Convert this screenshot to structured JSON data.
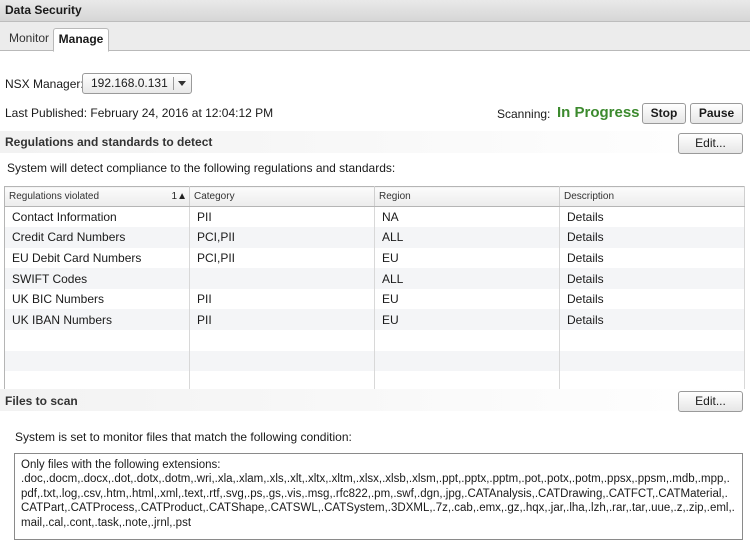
{
  "title": "Data Security",
  "tabs": [
    {
      "label": "Monitor"
    },
    {
      "label": "Manage"
    }
  ],
  "nsx": {
    "label": "NSX Manager:",
    "selected": "192.168.0.131"
  },
  "published": "Last Published: February 24, 2016 at 12:04:12 PM",
  "scanning": {
    "label": "Scanning:",
    "status": "In Progress",
    "status_color": "#3c8a2e",
    "stop_label": "Stop",
    "pause_label": "Pause"
  },
  "regulations": {
    "title": "Regulations and standards to detect",
    "edit_label": "Edit...",
    "description": "System will detect compliance to the following regulations and standards:",
    "columns": [
      "Regulations violated",
      "Category",
      "Region",
      "Description"
    ],
    "sort_indicator": "1▲",
    "rows": [
      [
        "Contact Information",
        "PII",
        "NA",
        "Details"
      ],
      [
        "Credit Card Numbers",
        "PCI,PII",
        "ALL",
        "Details"
      ],
      [
        "EU Debit Card Numbers",
        "PCI,PII",
        "EU",
        "Details"
      ],
      [
        "SWIFT Codes",
        "",
        "ALL",
        "Details"
      ],
      [
        "UK BIC Numbers",
        "PII",
        "EU",
        "Details"
      ],
      [
        "UK IBAN Numbers",
        "PII",
        "EU",
        "Details"
      ]
    ]
  },
  "files": {
    "title": "Files to scan",
    "edit_label": "Edit...",
    "description": "System is set to monitor files that match the following condition:",
    "box_heading": "Only files with the following extensions:",
    "extensions": ".doc,.docm,.docx,.dot,.dotx,.dotm,.wri,.xla,.xlam,.xls,.xlt,.xltx,.xltm,.xlsx,.xlsb,.xlsm,.ppt,.pptx,.pptm,.pot,.potx,.potm,.ppsx,.ppsm,.mdb,.mpp,.pdf,.txt,.log,.csv,.htm,.html,.xml,.text,.rtf,.svg,.ps,.gs,.vis,.msg,.rfc822,.pm,.swf,.dgn,.jpg,.CATAnalysis,.CATDrawing,.CATFCT,.CATMaterial,.CATPart,.CATProcess,.CATProduct,.CATShape,.CATSWL,.CATSystem,.3DXML,.7z,.cab,.emx,.gz,.hqx,.jar,.lha,.lzh,.rar,.tar,.uue,.z,.zip,.eml,.mail,.cal,.cont,.task,.note,.jrnl,.pst"
  }
}
